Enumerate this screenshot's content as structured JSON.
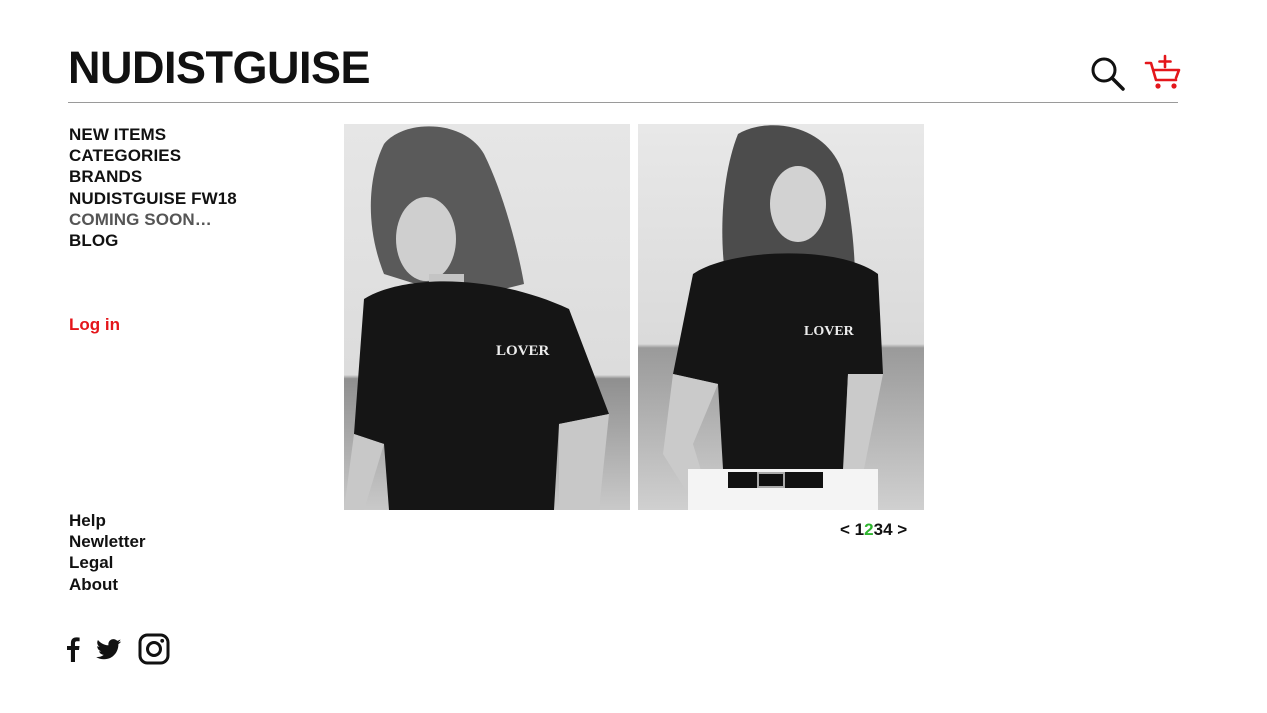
{
  "brand": {
    "logo": "NUDISTGUISE"
  },
  "header": {
    "search_icon": "search-icon",
    "cart_icon": "add-to-cart-icon",
    "cart_color": "#e4161b"
  },
  "nav": {
    "items": [
      {
        "label": "NEW ITEMS"
      },
      {
        "label": "CATEGORIES"
      },
      {
        "label": "BRANDS"
      },
      {
        "label": "NUDISTGUISE FW18"
      },
      {
        "label": "COMING SOON…"
      },
      {
        "label": "BLOG"
      }
    ]
  },
  "account": {
    "login_label": "Log in",
    "login_color": "#e4161b"
  },
  "footer": {
    "links": [
      {
        "label": "Help"
      },
      {
        "label": "Newletter"
      },
      {
        "label": "Legal"
      },
      {
        "label": "About"
      }
    ]
  },
  "social": {
    "icons": [
      "facebook-icon",
      "twitter-icon",
      "instagram-icon"
    ]
  },
  "gallery": {
    "images": [
      {
        "shirt_text": "LOVER"
      },
      {
        "shirt_text": "LOVER"
      }
    ]
  },
  "pagination": {
    "prev": "<",
    "next": ">",
    "pages": [
      "1",
      "2",
      "3",
      "4"
    ],
    "current": "2",
    "active_color": "#2db52d"
  }
}
